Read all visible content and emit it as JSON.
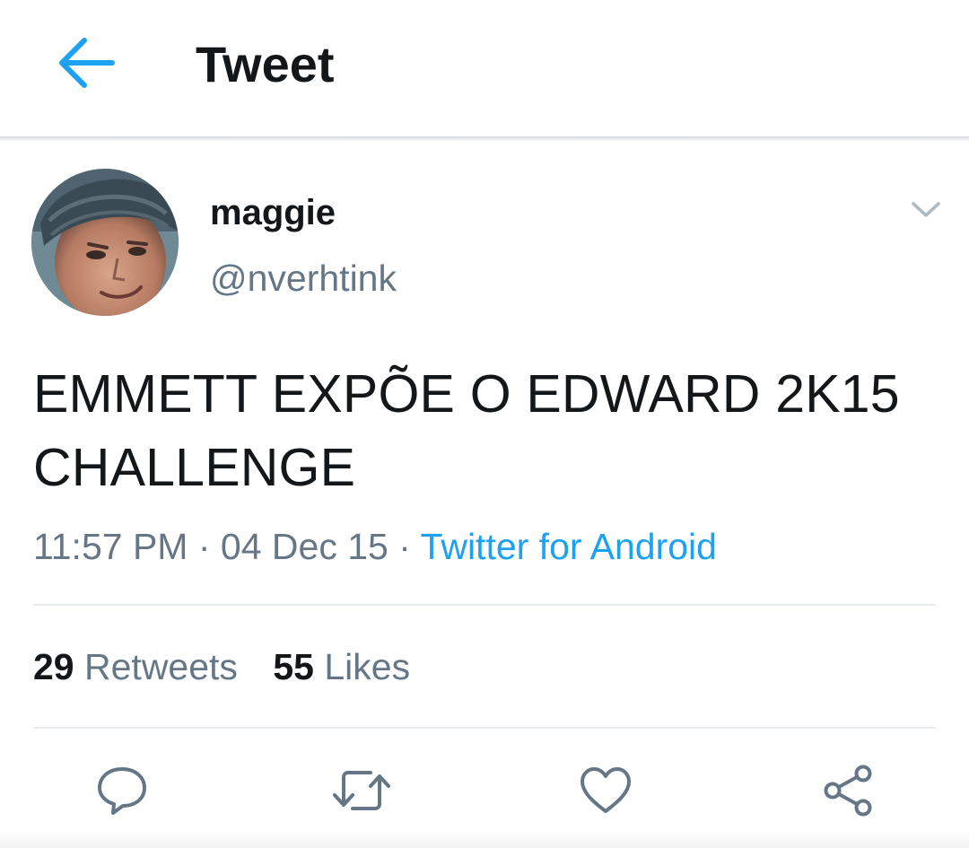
{
  "header": {
    "title": "Tweet",
    "back_icon": "arrow-left-icon",
    "accent_color": "#1da1f2"
  },
  "tweet": {
    "author": {
      "display_name": "maggie",
      "handle": "@nverhtink",
      "avatar_icon": "user-avatar"
    },
    "menu_icon": "chevron-down-icon",
    "text_line1": "EMMETT EXPÕE O EDWARD 2K15",
    "text_line2": "CHALLENGE",
    "time": "11:57 PM",
    "separator": "·",
    "date": "04 Dec 15",
    "source": "Twitter for Android",
    "retweets": {
      "count": "29",
      "label": "Retweets"
    },
    "likes": {
      "count": "55",
      "label": "Likes"
    }
  },
  "actions": {
    "reply_icon": "reply-icon",
    "retweet_icon": "retweet-icon",
    "like_icon": "heart-icon",
    "share_icon": "share-icon"
  },
  "colors": {
    "text_primary": "#14171a",
    "text_secondary": "#657786",
    "link": "#1da1f2",
    "divider": "#e6ecf0"
  }
}
